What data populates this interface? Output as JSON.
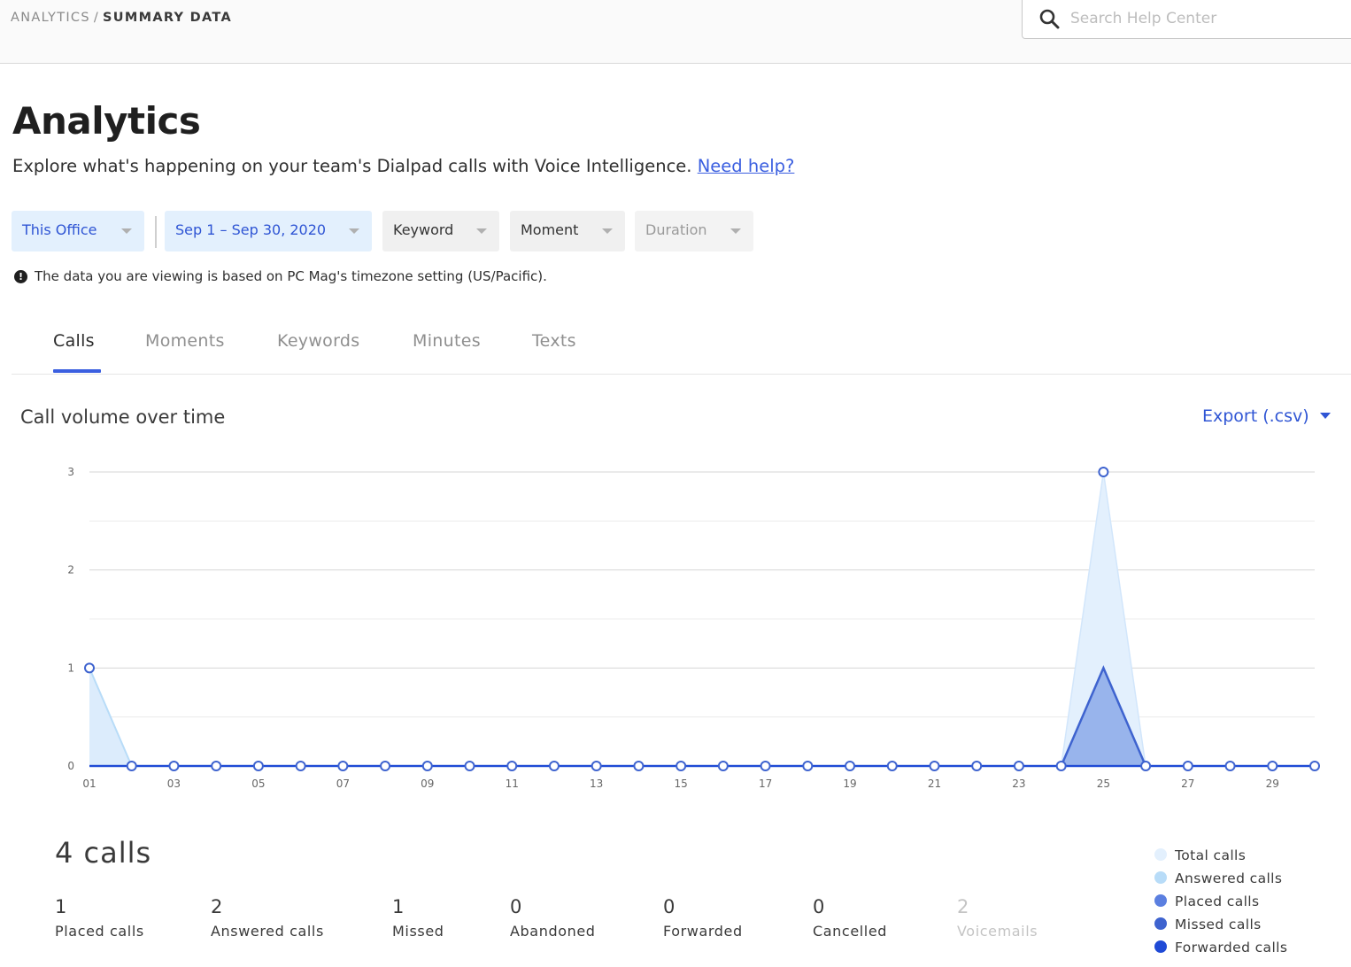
{
  "breadcrumb": {
    "parent": "ANALYTICS",
    "separator": "/",
    "current": "SUMMARY DATA"
  },
  "search": {
    "placeholder": "Search Help Center",
    "value": ""
  },
  "page": {
    "title": "Analytics",
    "subtitle": "Explore what's happening on your team's Dialpad calls with Voice Intelligence.",
    "help_link": "Need help?"
  },
  "filters": {
    "office": "This Office",
    "date_range": "Sep 1 – Sep 30, 2020",
    "keyword": "Keyword",
    "moment": "Moment",
    "duration": "Duration"
  },
  "timezone_note": "The data you are viewing is based on PC Mag's timezone setting (US/Pacific).",
  "tabs": [
    "Calls",
    "Moments",
    "Keywords",
    "Minutes",
    "Texts"
  ],
  "active_tab": "Calls",
  "chart_section": {
    "title": "Call volume over time",
    "export_label": "Export (.csv)"
  },
  "colors": {
    "accent": "#3b5fe0",
    "total": "#e3f0fd",
    "answered": "#b8dcf8",
    "placed": "#5b7fe0",
    "missed": "#3e63cf",
    "forwarded": "#1f4ad6"
  },
  "chart_data": {
    "type": "area",
    "x": [
      "01",
      "02",
      "03",
      "04",
      "05",
      "06",
      "07",
      "08",
      "09",
      "10",
      "11",
      "12",
      "13",
      "14",
      "15",
      "16",
      "17",
      "18",
      "19",
      "20",
      "21",
      "22",
      "23",
      "24",
      "25",
      "26",
      "27",
      "28",
      "29",
      "30"
    ],
    "x_tick_labels": [
      "01",
      "03",
      "05",
      "07",
      "09",
      "11",
      "13",
      "15",
      "17",
      "19",
      "21",
      "23",
      "25",
      "27",
      "29"
    ],
    "y_tick_labels": [
      "0",
      "1",
      "2",
      "3"
    ],
    "ylim": [
      0,
      3
    ],
    "grid": true,
    "series": [
      {
        "name": "Total calls",
        "values": [
          1,
          0,
          0,
          0,
          0,
          0,
          0,
          0,
          0,
          0,
          0,
          0,
          0,
          0,
          0,
          0,
          0,
          0,
          0,
          0,
          0,
          0,
          0,
          0,
          3,
          0,
          0,
          0,
          0,
          0
        ]
      },
      {
        "name": "Answered calls",
        "values": [
          1,
          0,
          0,
          0,
          0,
          0,
          0,
          0,
          0,
          0,
          0,
          0,
          0,
          0,
          0,
          0,
          0,
          0,
          0,
          0,
          0,
          0,
          0,
          0,
          1,
          0,
          0,
          0,
          0,
          0
        ]
      },
      {
        "name": "Placed calls",
        "values": [
          0,
          0,
          0,
          0,
          0,
          0,
          0,
          0,
          0,
          0,
          0,
          0,
          0,
          0,
          0,
          0,
          0,
          0,
          0,
          0,
          0,
          0,
          0,
          0,
          1,
          0,
          0,
          0,
          0,
          0
        ]
      },
      {
        "name": "Missed calls",
        "values": [
          0,
          0,
          0,
          0,
          0,
          0,
          0,
          0,
          0,
          0,
          0,
          0,
          0,
          0,
          0,
          0,
          0,
          0,
          0,
          0,
          0,
          0,
          0,
          0,
          1,
          0,
          0,
          0,
          0,
          0
        ]
      },
      {
        "name": "Forwarded calls",
        "values": [
          0,
          0,
          0,
          0,
          0,
          0,
          0,
          0,
          0,
          0,
          0,
          0,
          0,
          0,
          0,
          0,
          0,
          0,
          0,
          0,
          0,
          0,
          0,
          0,
          0,
          0,
          0,
          0,
          0,
          0
        ]
      }
    ]
  },
  "summary": {
    "total": "4 calls",
    "stats": [
      {
        "value": "1",
        "label": "Placed calls"
      },
      {
        "value": "2",
        "label": "Answered calls"
      },
      {
        "value": "1",
        "label": "Missed"
      },
      {
        "value": "0",
        "label": "Abandoned"
      },
      {
        "value": "0",
        "label": "Forwarded"
      },
      {
        "value": "0",
        "label": "Cancelled"
      },
      {
        "value": "2",
        "label": "Voicemails"
      }
    ]
  },
  "legend": [
    "Total calls",
    "Answered calls",
    "Placed calls",
    "Missed calls",
    "Forwarded calls"
  ]
}
